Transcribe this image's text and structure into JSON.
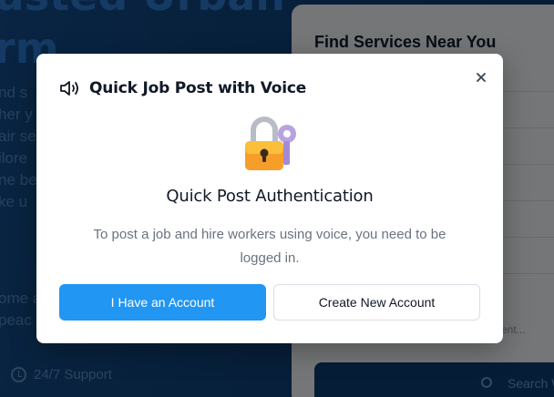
{
  "background": {
    "hero_title": "usted Urban\nrm",
    "hero_lines": [
      "nd s",
      "her y",
      "air se",
      "ilore",
      "ne be",
      "ke u"
    ],
    "hero_lines2": [
      "ome a",
      "peac"
    ],
    "support_label": "24/7 Support",
    "card_title": "Find Services Near You",
    "card_fragment": "ent...",
    "search_button_label": "Search W"
  },
  "modal": {
    "title": "Quick Job Post with Voice",
    "heading": "Quick Post Authentication",
    "description": "To post a job and hire workers using voice, you need to be logged in.",
    "primary_button": "I Have an Account",
    "secondary_button": "Create New Account"
  },
  "icons": {
    "header": "speaker-icon",
    "close": "close-icon",
    "hero": "lock-with-key-icon",
    "support": "clock-icon",
    "search": "search-icon"
  },
  "colors": {
    "primary": "#2196f3",
    "text": "#111827",
    "muted": "#6b7280"
  }
}
